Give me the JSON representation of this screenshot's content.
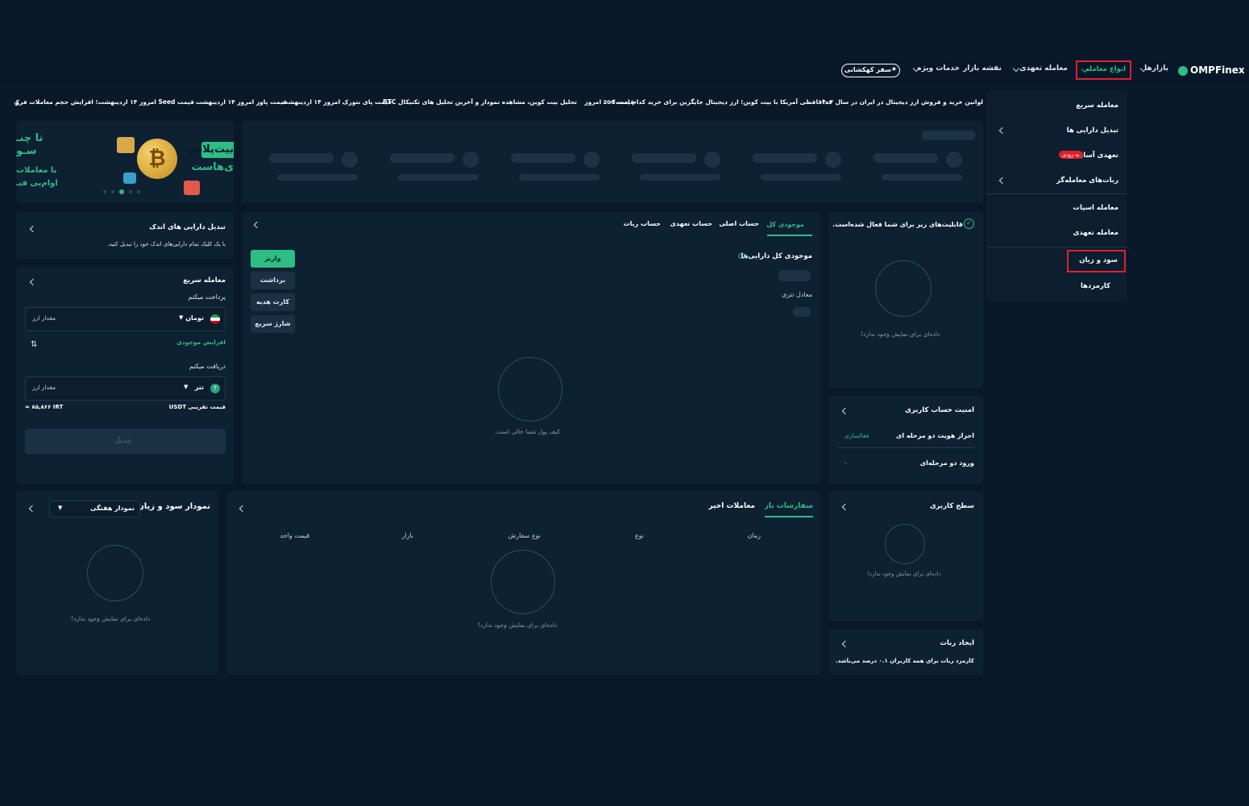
{
  "nav": {
    "logo": "OMPFinex",
    "markets": "بازارها",
    "trade_types": "انواع معامله",
    "futures": "معامله تعهدی",
    "market_map": "نقشه بازار",
    "special_services": "خدمات ویژه",
    "galaxy": "سفر کهکشانی"
  },
  "ticker": [
    "لوانین خرید و فروش ارز دیجیتال در ایران در سال ۱۴۰۴",
    "خداحافظی آمریکا با بیت کوین؛ ارز دیجیتال جایگزین برای خرید کدام است؟",
    "قیمت zoo امروز",
    "تحلیل بیت کوین، مشاهده نمودار و آخرین تحلیل های تکنیکال BTC",
    "قیمت پای نتورک امروز ۱۴ اردیبهشت",
    "قیمت پاوز امروز ۱۴ اردیبهشت",
    "قیمت Seed امروز ۱۴ اردیبهشت؛ افزایش حجم معاملات فروش",
    "ک"
  ],
  "dropdown": {
    "items": [
      "معامله سریع",
      "تبدیل دارایی ها",
      "تعهدی آسان",
      "ربات‌های معامله‌گر",
      "معامله اسپات",
      "معامله تعهدی",
      "سود و زیان",
      "کارمزدها"
    ],
    "badge": "به زودی"
  },
  "banner": {
    "line1": "بیت‌پلاس",
    "line2": "ی‌هاست",
    "left1": "تا چنـ",
    "left2": "سـو",
    "left3": "با معاملات",
    "left4": "اوام‌پی فیـ"
  },
  "features": {
    "title": "قابلیت‌های زیر برای شما فعال شده‌است.",
    "empty": "داده‌ای برای نمایش وجود ندارد!"
  },
  "wallet": {
    "tabs": [
      "موجودی کل",
      "حساب اصلی",
      "حساب تعهدی",
      "حساب ربات"
    ],
    "total_label": "موجودی کل دارایی‌ها",
    "tether_label": "معادل تتری",
    "deposit": "واریز",
    "withdraw": "برداشت",
    "gift": "کارت هدیه",
    "quick_charge": "شارژ سریع",
    "empty": "کیف پول شما خالی است."
  },
  "convert_small": {
    "title": "تبدیل دارایی های اندک",
    "desc": "با یک کلیک تمام دارایی‌های اندک خود را تبدیل کنید."
  },
  "quick_trade": {
    "title": "معامله سریع",
    "pay_label": "پرداخت میکنم",
    "pay_currency": "تومان",
    "amount_placeholder": "مقدار ارز",
    "increase": "افزایش موجودی",
    "receive_label": "دریافت میکنم",
    "receive_currency": "تتر",
    "approx_label": "قیمت تقریبی USDT",
    "approx_value": "≈ ۸۵,۸۶۶ IRT",
    "convert_btn": "تبدیل"
  },
  "security": {
    "title": "امنیت حساب کاربری",
    "twofa": "احراز هویت دو مرحله ای",
    "activate": "فعالسازی",
    "login2": "ورود دو مرحله‌ای",
    "dash": "-"
  },
  "level": {
    "title": "سطح کاربری",
    "empty": "داده‌ای برای نمایش وجود ندارد!"
  },
  "bot": {
    "title": "ایجاد ربات",
    "desc": "کارمزد ربات برای همه کاربران ۰.۱ درصد می‌باشد."
  },
  "orders": {
    "tab_open": "سفارشات باز",
    "tab_recent": "معاملات اخیر",
    "cols": [
      "زمان",
      "نوع",
      "نوع سفارش",
      "بازار",
      "قیمت واحد"
    ],
    "empty": "داده‌ای برای نمایش وجود ندارد!"
  },
  "pnl": {
    "title": "نمودار سود و زیان",
    "select": "نمودار هفتگی",
    "empty": "داده‌ای برای نمایش وجود ندارد!"
  },
  "colors": {
    "bg": "#0a1929",
    "card": "#0d2133",
    "accent": "#2ebd85",
    "highlight": "#e0202e"
  }
}
